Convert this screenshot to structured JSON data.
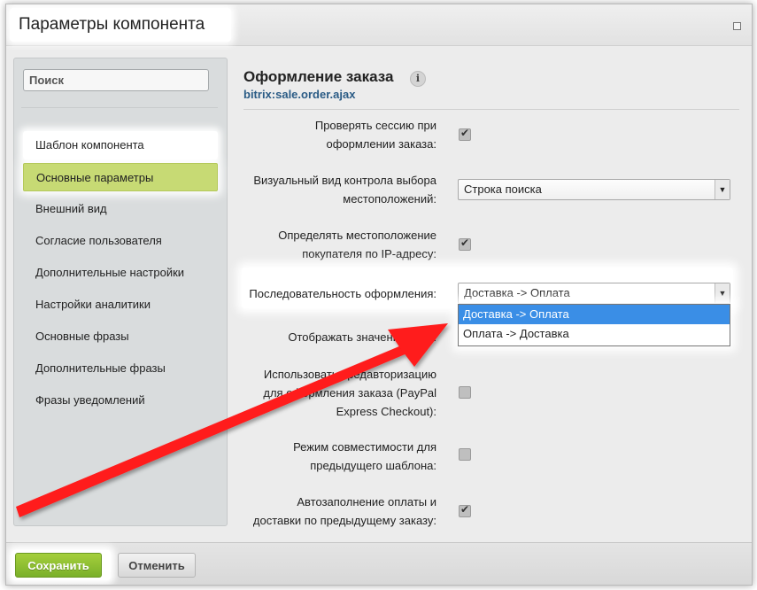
{
  "window": {
    "title": "Параметры компонента"
  },
  "sidebar": {
    "search_placeholder": "Поиск",
    "items": [
      {
        "label": "Шаблон компонента"
      },
      {
        "label": "Основные параметры"
      },
      {
        "label": "Внешний вид"
      },
      {
        "label": "Согласие пользователя"
      },
      {
        "label": "Дополнительные настройки"
      },
      {
        "label": "Настройки аналитики"
      },
      {
        "label": "Основные фразы"
      },
      {
        "label": "Дополнительные фразы"
      },
      {
        "label": "Фразы уведомлений"
      }
    ]
  },
  "main": {
    "title": "Оформление заказа",
    "info_icon": "i",
    "subtitle": "bitrix:sale.order.ajax",
    "rows": [
      {
        "label_l1": "Проверять сессию при",
        "label_l2": "оформлении заказа:",
        "checked": true
      },
      {
        "label_l1": "Визуальный вид контрола выбора",
        "label_l2": "местоположений:",
        "value": "Строка поиска"
      },
      {
        "label_l1": "Определять местоположение",
        "label_l2": "покупателя по IP-адресу:",
        "checked": true
      },
      {
        "label": "Последовательность оформления:",
        "value": "Доставка -> Оплата",
        "options": [
          "Доставка -> Оплата",
          "Оплата -> Доставка"
        ]
      },
      {
        "label": "Отображать значение НДС:"
      },
      {
        "label_l1": "Использовать предавторизацию",
        "label_l2": "для оформления заказа (PayPal",
        "label_l3": "Express Checkout):",
        "checked": false
      },
      {
        "label_l1": "Режим совместимости для",
        "label_l2": "предыдущего шаблона:",
        "checked": false
      },
      {
        "label_l1": "Автозаполнение оплаты и",
        "label_l2": "доставки по предыдущему заказу:",
        "checked": true
      }
    ]
  },
  "buttons": {
    "save": "Сохранить",
    "cancel": "Отменить"
  },
  "colors": {
    "accent_green": "#c7da74",
    "selected_option": "#3a8ee6",
    "annotation_arrow": "#ff1a1a",
    "subtitle": "#2a5b85"
  }
}
